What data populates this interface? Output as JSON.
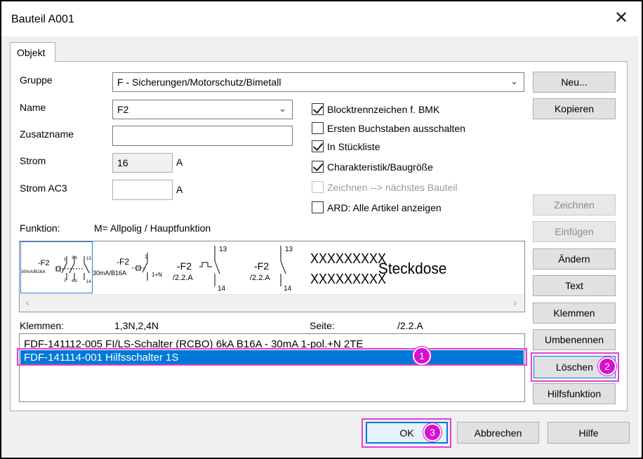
{
  "window": {
    "title": "Bauteil A001",
    "close_glyph": "✕"
  },
  "tabs": [
    {
      "label": "Objekt"
    }
  ],
  "form": {
    "gruppe_label": "Gruppe",
    "gruppe_value": "F - Sicherungen/Motorschutz/Bimetall",
    "name_label": "Name",
    "name_value": "F2",
    "zusatzname_label": "Zusatzname",
    "zusatzname_value": "",
    "strom_label": "Strom",
    "strom_value": "16",
    "strom_unit": "A",
    "strom_ac3_label": "Strom AC3",
    "strom_ac3_value": "",
    "strom_ac3_unit": "A"
  },
  "checkboxes": [
    {
      "label": "Blocktrennzeichen f. BMK",
      "checked": true,
      "enabled": true
    },
    {
      "label": "Ersten Buchstaben ausschalten",
      "checked": false,
      "enabled": true
    },
    {
      "label": "In Stückliste",
      "checked": true,
      "enabled": true
    },
    {
      "label": "Charakteristik/Baugröße",
      "checked": true,
      "enabled": true
    },
    {
      "label": "Zeichnen --> nächstes Bauteil",
      "checked": false,
      "enabled": false
    },
    {
      "label": "ARD: Alle Artikel anzeigen",
      "checked": false,
      "enabled": true
    }
  ],
  "funktion": {
    "label": "Funktion:",
    "value": "M= Allpolig / Hauptfunktion"
  },
  "symbols": {
    "s1": {
      "ref": "-F2",
      "rating": "30mA/B16A",
      "t1": "1",
      "t3": "3N",
      "t13": "13",
      "t2": "2",
      "t4": "4N",
      "t14": "14"
    },
    "s2": {
      "ref": "-F2",
      "rating": "30mA/B16A",
      "t1": "1",
      "t2": "1+N"
    },
    "s3": {
      "ref": "-F2",
      "page": "/2.2.A",
      "t13": "13",
      "t14": "14"
    },
    "s4": {
      "ref": "-F2",
      "page": "/2.2.A",
      "t13": "13",
      "t14": "14"
    },
    "s5": {
      "line1": "XXXXXXXXX",
      "line2": "XXXXXXXXX",
      "text": "Steckdose"
    }
  },
  "klemmen": {
    "label": "Klemmen:",
    "value": "1,3N,2,4N",
    "seite_label": "Seite:",
    "seite_value": "/2.2.A"
  },
  "articles": [
    {
      "text": "FDF-141112-005  FI/LS-Schalter (RCBO) 6kA  B16A - 30mA  1-pol.+N  2TE",
      "selected": false
    },
    {
      "text": "FDF-141114-001  Hilfsschalter 1S",
      "selected": true
    }
  ],
  "side_buttons": {
    "neu": "Neu...",
    "kopieren": "Kopieren",
    "zeichnen": "Zeichnen",
    "einfuegen": "Einfügen",
    "aendern": "Ändern",
    "text": "Text",
    "klemmen": "Klemmen",
    "umbenennen": "Umbenennen",
    "loeschen": "Löschen",
    "hilfsfunktion": "Hilfsfunktion"
  },
  "bottom_buttons": {
    "ok": "OK",
    "abbrechen": "Abbrechen",
    "hilfe": "Hilfe"
  },
  "badges": {
    "b1": "1",
    "b2": "2",
    "b3": "3"
  },
  "colors": {
    "highlight": "#e33fd6",
    "badge": "#d80fcf",
    "selection": "#0078d7"
  }
}
